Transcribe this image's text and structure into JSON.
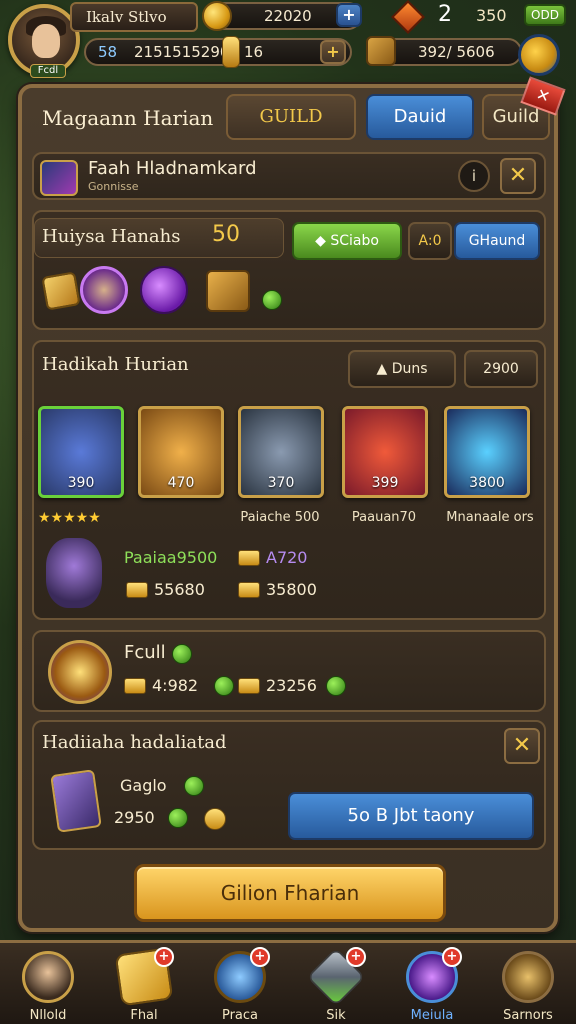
{
  "hud": {
    "player_name": "Ikalv Stlvo",
    "player_level": "Fcdl",
    "gold_amount": "22020",
    "gem_count": "2",
    "gem_amount": "350",
    "gold_badge": "ODD",
    "power_label": "58",
    "power_value": "2151515290",
    "keys_value": "16",
    "crates_value": "392/ 5606"
  },
  "tabs": {
    "title": "Magaann Harian",
    "guild_gold": "GUILD",
    "active": "Dauid",
    "guild_plain": "Guild"
  },
  "player_row": {
    "title": "Faah Hladnamkard",
    "subtitle": "Gonnisse"
  },
  "daily": {
    "title": "Huiysa Hanahs",
    "count": "50",
    "btn_green": "SCiabo",
    "chip": "A:0",
    "btn_blue": "GHaund"
  },
  "rewards": {
    "title": "Hadikah Hurian",
    "chip_label": "Duns",
    "chip_value": "2900",
    "cards": [
      {
        "value": "390",
        "caption": "",
        "color": "#2a3a6a",
        "border": "#6ad13a"
      },
      {
        "value": "470",
        "caption": "",
        "color": "#7a4a14",
        "border": "#c9a048"
      },
      {
        "value": "370",
        "caption": "Paiache 500",
        "color": "#2a3440",
        "border": "#c9a048"
      },
      {
        "value": "399",
        "caption": "Paauan70",
        "color": "#7a1a2a",
        "border": "#c9a048"
      },
      {
        "value": "3800",
        "caption": "Mnanaale ors",
        "color": "#1a2a5a",
        "border": "#c9a048"
      }
    ],
    "stars": "★★★★★",
    "green_value": "Paaiaa9500",
    "purple_value": "A720",
    "value_a": "55680",
    "value_b": "35800"
  },
  "full_row": {
    "title": "Fcull",
    "value_a": "4:982",
    "value_b": "23256"
  },
  "guild_row": {
    "title": "Hadiiaha hadaliatad",
    "item_name": "Gaglo",
    "item_value": "2950",
    "btn_label": "5o B Jbt taony"
  },
  "claim_button": "Gilion Fharian",
  "nav": [
    {
      "label": "Nllold",
      "icon": "hero-portrait-icon",
      "active": false,
      "dot": ""
    },
    {
      "label": "Fhal",
      "icon": "scroll-icon",
      "active": false,
      "dot": "+"
    },
    {
      "label": "Praca",
      "icon": "magnifier-icon",
      "active": false,
      "dot": "+"
    },
    {
      "label": "Sik",
      "icon": "sword-icon",
      "active": false,
      "dot": "+"
    },
    {
      "label": "Meiula",
      "icon": "crystal-icon",
      "active": true,
      "dot": "+"
    },
    {
      "label": "Sarnors",
      "icon": "helmet-icon",
      "active": false,
      "dot": ""
    }
  ]
}
